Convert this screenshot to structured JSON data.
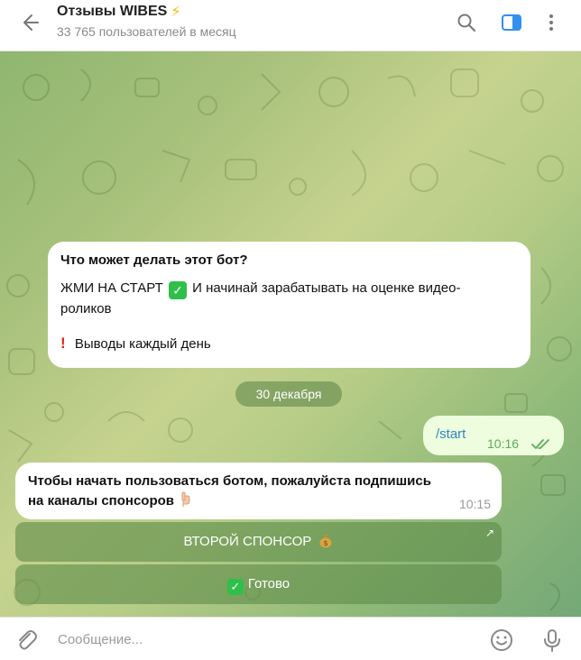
{
  "header": {
    "title": "Отзывы WIBES",
    "title_emoji": "⚡",
    "subtitle": "33 765 пользователей в месяц"
  },
  "messages": {
    "intro": {
      "title": "Что может делать этот бот?",
      "line1_a": "ЖМИ НА СТАРТ",
      "line1_check": "✓",
      "line1_b": "И начинай зарабатывать на оценке видео-",
      "line2": "роликов",
      "line3_mark": "!",
      "line3": "Выводы каждый день"
    },
    "date_chip": "30 декабря",
    "outgoing": {
      "text": "/start",
      "time": "10:16"
    },
    "bot": {
      "line1": "Чтобы начать пользоваться ботом, пожалуйста подпишись",
      "line2": "на каналы спонсоров",
      "time": "10:15"
    }
  },
  "keyboard": {
    "button1": "ВТОРОЙ СПОНСОР",
    "button1_arrow": "↗",
    "button2_check": "✓",
    "button2": "Готово"
  },
  "composer": {
    "placeholder": "Сообщение..."
  },
  "colors": {
    "accent": "#2e86c1",
    "outgoing_bubble": "#eefdde",
    "read_ticks": "#5caa5c",
    "check": "#2fbf4a",
    "bolt": "#f5b800"
  }
}
